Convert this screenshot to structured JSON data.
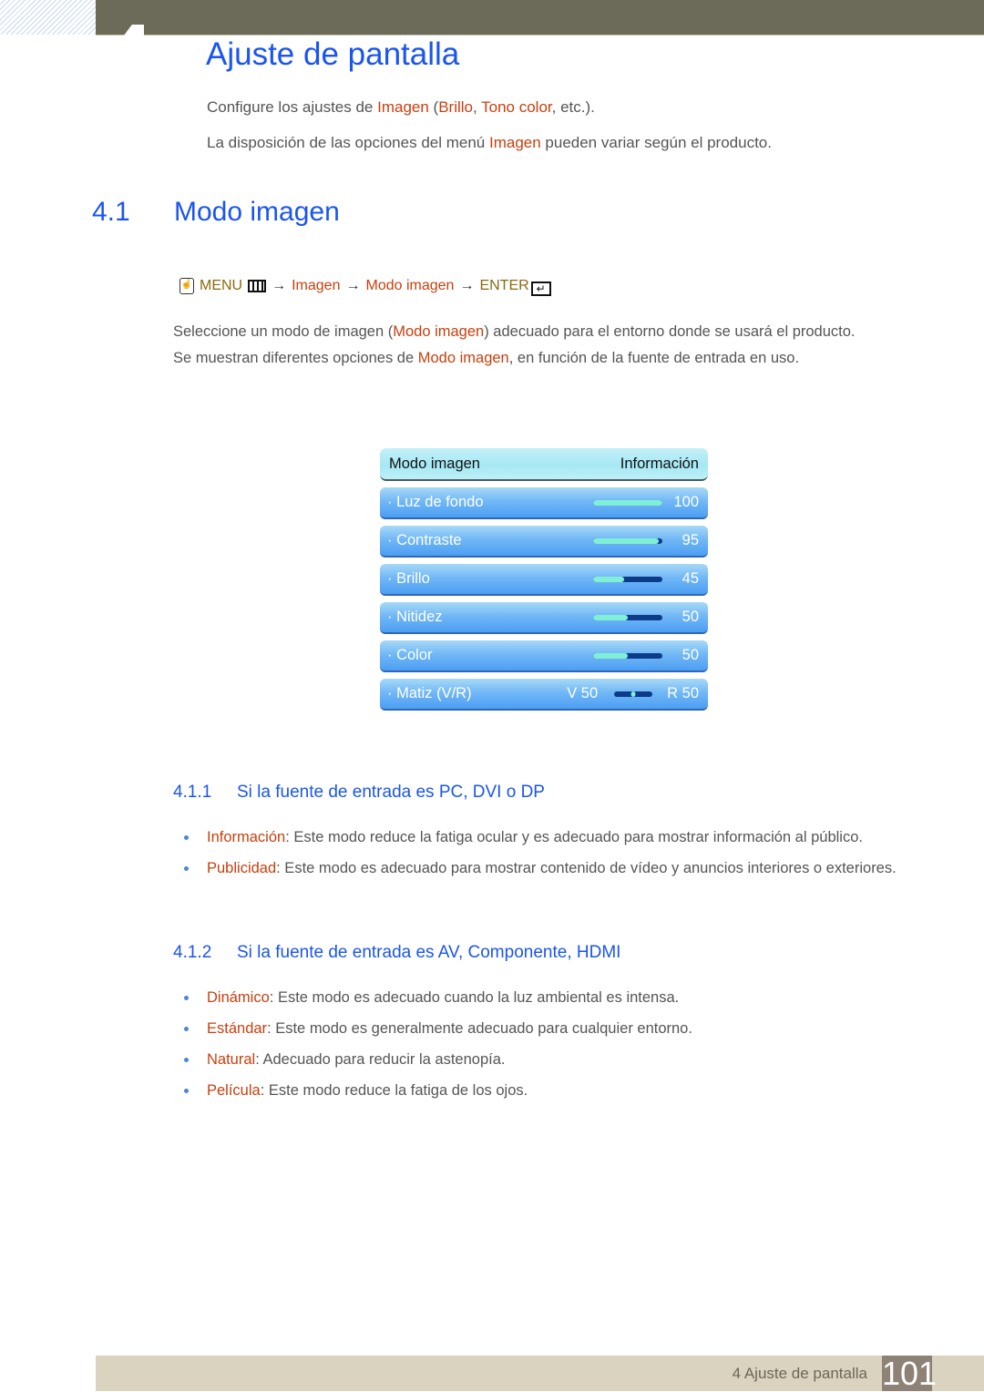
{
  "header": {
    "title": "Ajuste de pantalla"
  },
  "intro": {
    "line1": {
      "pre": "Configure los ajustes de ",
      "hl1": "Imagen",
      "mid1": " (",
      "hl2": "Brillo",
      "mid2": ", ",
      "hl3": "Tono color",
      "post": ", etc.)."
    },
    "line2": {
      "pre": "La disposición de las opciones del menú ",
      "hl": "Imagen",
      "post": " pueden variar según el producto."
    }
  },
  "section": {
    "number": "4.1",
    "title": "Modo imagen"
  },
  "menu_path": {
    "menu": "MENU",
    "arrow": "→",
    "step1": "Imagen",
    "step2": "Modo imagen",
    "enter": "ENTER",
    "enter_icon": "↵",
    "hand_icon": "☝"
  },
  "paragraph": {
    "line1": {
      "pre": "Seleccione un modo de imagen (",
      "hl": "Modo imagen",
      "post": ") adecuado para el entorno donde se usará el producto."
    },
    "line2": {
      "pre": "Se muestran diferentes opciones de ",
      "hl": "Modo imagen",
      "post": ", en función de la fuente de entrada en uso."
    }
  },
  "osd": {
    "header_label": "Modo imagen",
    "header_value": "Información",
    "rows": [
      {
        "label": "· Luz de fondo",
        "value": "100",
        "percent": 100
      },
      {
        "label": "· Contraste",
        "value": "95",
        "percent": 95
      },
      {
        "label": "· Brillo",
        "value": "45",
        "percent": 45
      },
      {
        "label": "· Nitidez",
        "value": "50",
        "percent": 50
      },
      {
        "label": "· Color",
        "value": "50",
        "percent": 50
      }
    ],
    "hue": {
      "label": "· Matiz (V/R)",
      "v_label": "V 50",
      "r_label": "R 50",
      "position": 50
    }
  },
  "subsections": [
    {
      "number": "4.1.1",
      "title": "Si la fuente de entrada es PC, DVI o DP",
      "items": [
        {
          "term": "Información",
          "text": ": Este modo reduce la fatiga ocular y es adecuado para mostrar información al público."
        },
        {
          "term": "Publicidad",
          "text": ": Este modo es adecuado para mostrar contenido de vídeo y anuncios interiores o exteriores."
        }
      ]
    },
    {
      "number": "4.1.2",
      "title": "Si la fuente de entrada es AV, Componente, HDMI",
      "items": [
        {
          "term": "Dinámico",
          "text": ": Este modo es adecuado cuando la luz ambiental es intensa."
        },
        {
          "term": "Estándar",
          "text": ": Este modo es generalmente adecuado para cualquier entorno."
        },
        {
          "term": "Natural",
          "text": ": Adecuado para reducir la astenopía."
        },
        {
          "term": "Película",
          "text": ": Este modo reduce la fatiga de los ojos."
        }
      ]
    }
  ],
  "footer": {
    "chapter_label": "4 Ajuste de pantalla",
    "page_number": "101"
  }
}
